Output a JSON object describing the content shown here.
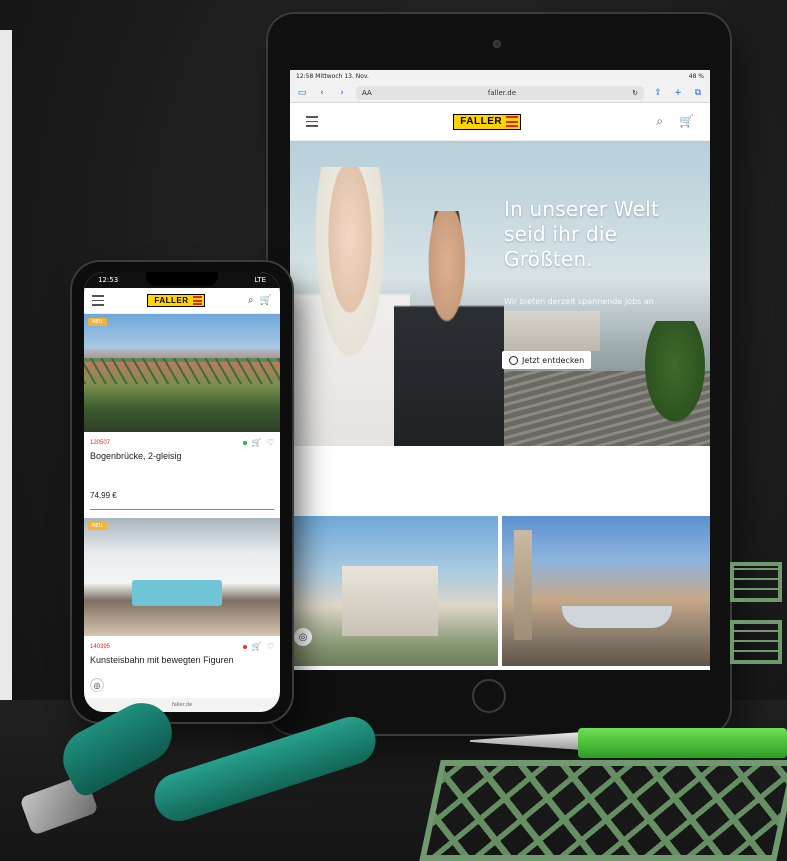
{
  "tablet": {
    "status_time": "12:58",
    "status_date": "Mittwoch 13. Nov.",
    "status_battery": "48 %",
    "url_text_size": "AA",
    "url_domain": "faller.de",
    "logo_text": "FALLER",
    "hero_headline": "In unserer Welt seid ihr die Größten.",
    "hero_subline": "Wir bieten derzeit spannende Jobs an",
    "hero_cta": "Jetzt entdecken"
  },
  "phone": {
    "status_time": "12:53",
    "status_network": "LTE",
    "logo_text": "FALLER",
    "products": [
      {
        "badge": "NEU",
        "article_no": "120507",
        "title": "Bogenbrücke, 2-gleisig",
        "price": "74,99 €",
        "status_color": "#2bb14b"
      },
      {
        "badge": "NEU",
        "article_no": "140395",
        "title": "Kunsteisbahn mit bewegten Figuren",
        "price": "",
        "status_color": "#e23a2c"
      }
    ],
    "url_domain": "faller.de"
  },
  "icons": {
    "menu": "☰",
    "search": "⌕",
    "cart": "🛒",
    "heart": "♡",
    "fingerprint": "◎",
    "reload": "↻",
    "share": "⇪",
    "plus": "+",
    "tabs": "⧉",
    "back": "‹",
    "forward": "›",
    "sidebar": "▭"
  }
}
